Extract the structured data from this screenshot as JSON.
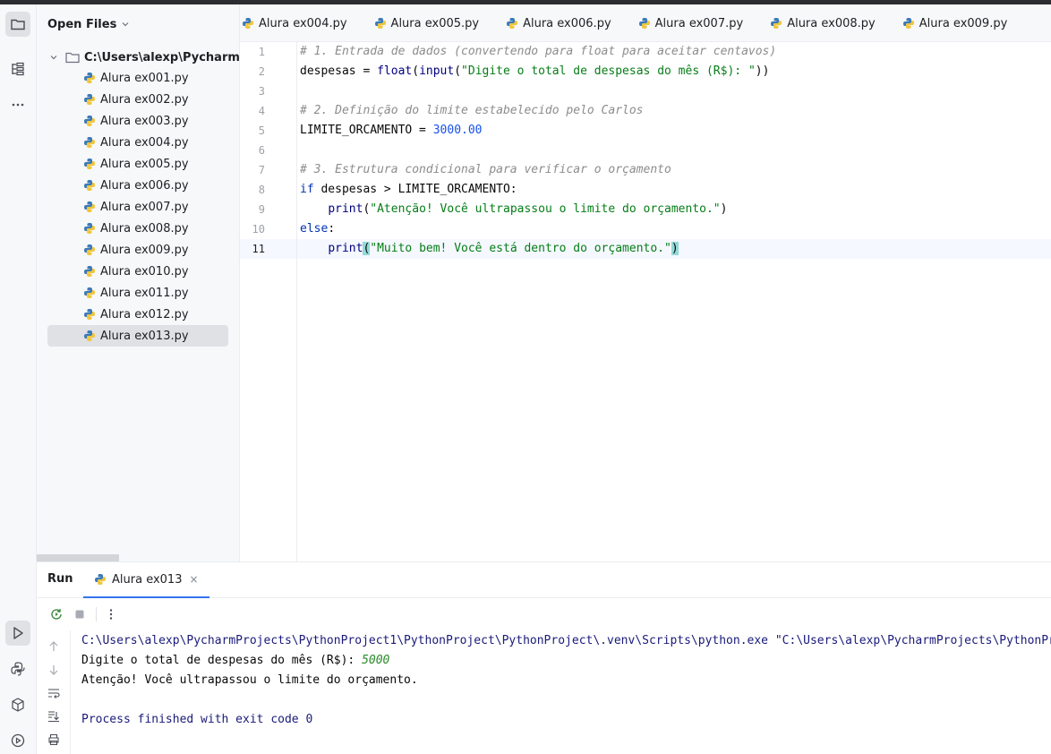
{
  "project_panel": {
    "title": "Open Files",
    "root_label": "C:\\Users\\alexp\\PycharmProj",
    "files": [
      "Alura ex001.py",
      "Alura ex002.py",
      "Alura ex003.py",
      "Alura ex004.py",
      "Alura ex005.py",
      "Alura ex006.py",
      "Alura ex007.py",
      "Alura ex008.py",
      "Alura ex009.py",
      "Alura ex010.py",
      "Alura ex011.py",
      "Alura ex012.py",
      "Alura ex013.py"
    ],
    "selected_file": "Alura ex013.py"
  },
  "editor_tabs": [
    "Alura ex004.py",
    "Alura ex005.py",
    "Alura ex006.py",
    "Alura ex007.py",
    "Alura ex008.py",
    "Alura ex009.py"
  ],
  "editor": {
    "line_numbers": [
      "1",
      "2",
      "3",
      "4",
      "5",
      "6",
      "7",
      "8",
      "9",
      "10",
      "11"
    ],
    "current_line": "11",
    "code": {
      "l1": "# 1. Entrada de dados (convertendo para float para aceitar centavos)",
      "l2_var": "despesas",
      "l2_eq": " = ",
      "l2_fn1": "float",
      "l2_p1": "(",
      "l2_fn2": "input",
      "l2_p2": "(",
      "l2_str": "\"Digite o total de despesas do mês (R$): \"",
      "l2_p3": "))",
      "l4": "# 2. Definição do limite estabelecido pelo Carlos",
      "l5_var": "LIMITE_ORCAMENTO",
      "l5_eq": " = ",
      "l5_num": "3000.00",
      "l7": "# 3. Estrutura condicional para verificar o orçamento",
      "l8_kw": "if",
      "l8_rest": " despesas > LIMITE_ORCAMENTO:",
      "l9_fn": "print",
      "l9_p1": "(",
      "l9_str": "\"Atenção! Você ultrapassou o limite do orçamento.\"",
      "l9_p2": ")",
      "l10_kw": "else",
      "l10_rest": ":",
      "l11_fn": "print",
      "l11_p1": "(",
      "l11_str": "\"Muito bem! Você está dentro do orçamento.\"",
      "l11_p2": ")"
    }
  },
  "run_panel": {
    "title": "Run",
    "tab_label": "Alura ex013",
    "close_glyph": "×",
    "console": {
      "path_line": "C:\\Users\\alexp\\PycharmProjects\\PythonProject1\\PythonProject\\PythonProject\\.venv\\Scripts\\python.exe \"C:\\Users\\alexp\\PycharmProjects\\PythonPro",
      "prompt": "Digite o total de despesas do mês (R$): ",
      "user_input": "5000",
      "output": "Atenção! Você ultrapassou o limite do orçamento.",
      "finish": "Process finished with exit code 0"
    }
  },
  "icons": {
    "tool_strip": [
      "folder-icon",
      "structure-icon",
      "more-icon"
    ],
    "tool_strip_bottom": [
      "run-icon",
      "python-console-icon",
      "python-packages-icon",
      "services-icon"
    ],
    "file": "python-file-icon",
    "run_toolbar": [
      "rerun-icon",
      "stop-icon",
      "more-vertical-icon"
    ],
    "run_side": [
      "scroll-up-icon",
      "scroll-down-icon",
      "soft-wrap-icon",
      "scroll-to-end-icon",
      "print-icon"
    ]
  },
  "colors": {
    "keyword": "#0033b3",
    "string": "#067d17",
    "number": "#1750eb",
    "comment": "#8c8c8c",
    "selection": "#dfe1e5",
    "accent": "#3574f0"
  }
}
